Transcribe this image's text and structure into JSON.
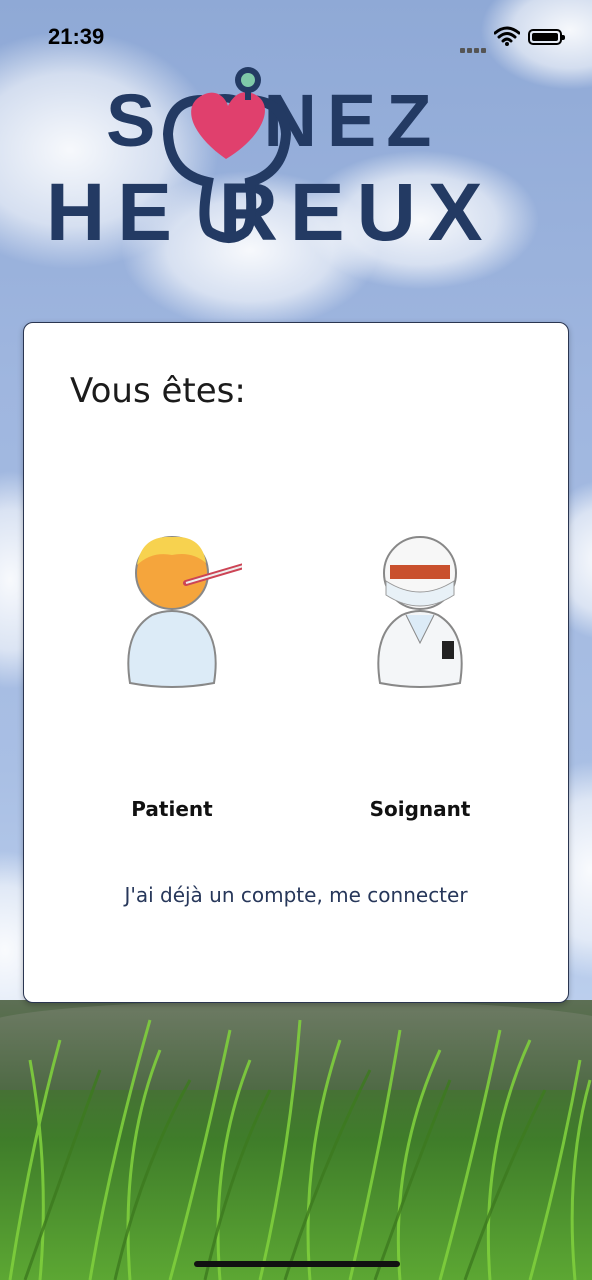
{
  "status_bar": {
    "time": "21:39"
  },
  "logo": {
    "line1": "SOIGNEZ",
    "line2": "HEUREUX",
    "line1_display": "S   GNEZ",
    "line2_display": "HE  REUX"
  },
  "card": {
    "title": "Vous êtes:",
    "login_link": "J'ai déjà un compte, me connecter"
  },
  "choices": [
    {
      "label": "Patient",
      "icon": "patient-icon"
    },
    {
      "label": "Soignant",
      "icon": "caregiver-icon"
    }
  ],
  "colors": {
    "brand_navy": "#233a63",
    "heart_pink": "#e0406d",
    "link": "#27375a"
  }
}
